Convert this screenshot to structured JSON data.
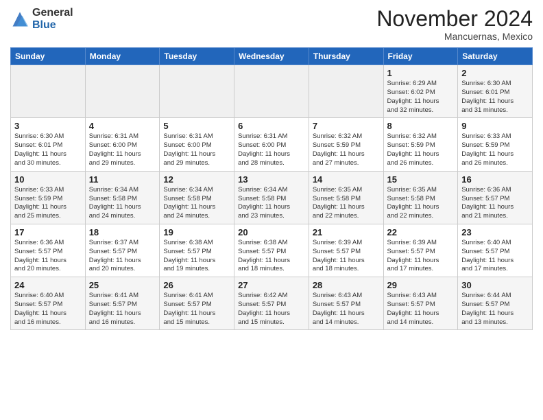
{
  "header": {
    "logo_general": "General",
    "logo_blue": "Blue",
    "month": "November 2024",
    "location": "Mancuernas, Mexico"
  },
  "weekdays": [
    "Sunday",
    "Monday",
    "Tuesday",
    "Wednesday",
    "Thursday",
    "Friday",
    "Saturday"
  ],
  "weeks": [
    [
      {
        "day": "",
        "info": ""
      },
      {
        "day": "",
        "info": ""
      },
      {
        "day": "",
        "info": ""
      },
      {
        "day": "",
        "info": ""
      },
      {
        "day": "",
        "info": ""
      },
      {
        "day": "1",
        "info": "Sunrise: 6:29 AM\nSunset: 6:02 PM\nDaylight: 11 hours\nand 32 minutes."
      },
      {
        "day": "2",
        "info": "Sunrise: 6:30 AM\nSunset: 6:01 PM\nDaylight: 11 hours\nand 31 minutes."
      }
    ],
    [
      {
        "day": "3",
        "info": "Sunrise: 6:30 AM\nSunset: 6:01 PM\nDaylight: 11 hours\nand 30 minutes."
      },
      {
        "day": "4",
        "info": "Sunrise: 6:31 AM\nSunset: 6:00 PM\nDaylight: 11 hours\nand 29 minutes."
      },
      {
        "day": "5",
        "info": "Sunrise: 6:31 AM\nSunset: 6:00 PM\nDaylight: 11 hours\nand 29 minutes."
      },
      {
        "day": "6",
        "info": "Sunrise: 6:31 AM\nSunset: 6:00 PM\nDaylight: 11 hours\nand 28 minutes."
      },
      {
        "day": "7",
        "info": "Sunrise: 6:32 AM\nSunset: 5:59 PM\nDaylight: 11 hours\nand 27 minutes."
      },
      {
        "day": "8",
        "info": "Sunrise: 6:32 AM\nSunset: 5:59 PM\nDaylight: 11 hours\nand 26 minutes."
      },
      {
        "day": "9",
        "info": "Sunrise: 6:33 AM\nSunset: 5:59 PM\nDaylight: 11 hours\nand 26 minutes."
      }
    ],
    [
      {
        "day": "10",
        "info": "Sunrise: 6:33 AM\nSunset: 5:59 PM\nDaylight: 11 hours\nand 25 minutes."
      },
      {
        "day": "11",
        "info": "Sunrise: 6:34 AM\nSunset: 5:58 PM\nDaylight: 11 hours\nand 24 minutes."
      },
      {
        "day": "12",
        "info": "Sunrise: 6:34 AM\nSunset: 5:58 PM\nDaylight: 11 hours\nand 24 minutes."
      },
      {
        "day": "13",
        "info": "Sunrise: 6:34 AM\nSunset: 5:58 PM\nDaylight: 11 hours\nand 23 minutes."
      },
      {
        "day": "14",
        "info": "Sunrise: 6:35 AM\nSunset: 5:58 PM\nDaylight: 11 hours\nand 22 minutes."
      },
      {
        "day": "15",
        "info": "Sunrise: 6:35 AM\nSunset: 5:58 PM\nDaylight: 11 hours\nand 22 minutes."
      },
      {
        "day": "16",
        "info": "Sunrise: 6:36 AM\nSunset: 5:57 PM\nDaylight: 11 hours\nand 21 minutes."
      }
    ],
    [
      {
        "day": "17",
        "info": "Sunrise: 6:36 AM\nSunset: 5:57 PM\nDaylight: 11 hours\nand 20 minutes."
      },
      {
        "day": "18",
        "info": "Sunrise: 6:37 AM\nSunset: 5:57 PM\nDaylight: 11 hours\nand 20 minutes."
      },
      {
        "day": "19",
        "info": "Sunrise: 6:38 AM\nSunset: 5:57 PM\nDaylight: 11 hours\nand 19 minutes."
      },
      {
        "day": "20",
        "info": "Sunrise: 6:38 AM\nSunset: 5:57 PM\nDaylight: 11 hours\nand 18 minutes."
      },
      {
        "day": "21",
        "info": "Sunrise: 6:39 AM\nSunset: 5:57 PM\nDaylight: 11 hours\nand 18 minutes."
      },
      {
        "day": "22",
        "info": "Sunrise: 6:39 AM\nSunset: 5:57 PM\nDaylight: 11 hours\nand 17 minutes."
      },
      {
        "day": "23",
        "info": "Sunrise: 6:40 AM\nSunset: 5:57 PM\nDaylight: 11 hours\nand 17 minutes."
      }
    ],
    [
      {
        "day": "24",
        "info": "Sunrise: 6:40 AM\nSunset: 5:57 PM\nDaylight: 11 hours\nand 16 minutes."
      },
      {
        "day": "25",
        "info": "Sunrise: 6:41 AM\nSunset: 5:57 PM\nDaylight: 11 hours\nand 16 minutes."
      },
      {
        "day": "26",
        "info": "Sunrise: 6:41 AM\nSunset: 5:57 PM\nDaylight: 11 hours\nand 15 minutes."
      },
      {
        "day": "27",
        "info": "Sunrise: 6:42 AM\nSunset: 5:57 PM\nDaylight: 11 hours\nand 15 minutes."
      },
      {
        "day": "28",
        "info": "Sunrise: 6:43 AM\nSunset: 5:57 PM\nDaylight: 11 hours\nand 14 minutes."
      },
      {
        "day": "29",
        "info": "Sunrise: 6:43 AM\nSunset: 5:57 PM\nDaylight: 11 hours\nand 14 minutes."
      },
      {
        "day": "30",
        "info": "Sunrise: 6:44 AM\nSunset: 5:57 PM\nDaylight: 11 hours\nand 13 minutes."
      }
    ]
  ]
}
